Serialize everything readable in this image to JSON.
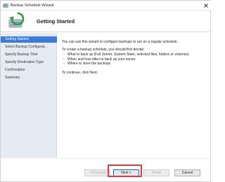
{
  "window": {
    "title": "Backup Schedule Wizard",
    "icons": {
      "app": "backup-app-icon",
      "close": "close-icon",
      "header": "backup-wizard-icon"
    }
  },
  "header": {
    "title": "Getting Started"
  },
  "sidebar": {
    "items": [
      {
        "label": "Getting Started",
        "active": true
      },
      {
        "label": "Select Backup Configurat...",
        "active": false
      },
      {
        "label": "Specify Backup Time",
        "active": false
      },
      {
        "label": "Specify Destination Type",
        "active": false
      },
      {
        "label": "Confirmation",
        "active": false
      },
      {
        "label": "Summary",
        "active": false
      }
    ]
  },
  "content": {
    "intro": "You can use this wizard to configure backups to run on a regular schedule.",
    "decide": "To create a backup schedule, you should first decide:",
    "bullets": [
      "What to back up (Full Server, System State, selected files, folders or volumes)",
      "When and how often to back up your server",
      "Where to store the backups"
    ],
    "continue": "To continue, click Next."
  },
  "buttons": {
    "previous": "< Previous",
    "next": "Next >",
    "finish": "Finish",
    "cancel": "Cancel"
  },
  "colors": {
    "accent": "#3d7dd8",
    "sidebar_bg": "#e6ebf3",
    "highlight": "#e03a3a"
  }
}
